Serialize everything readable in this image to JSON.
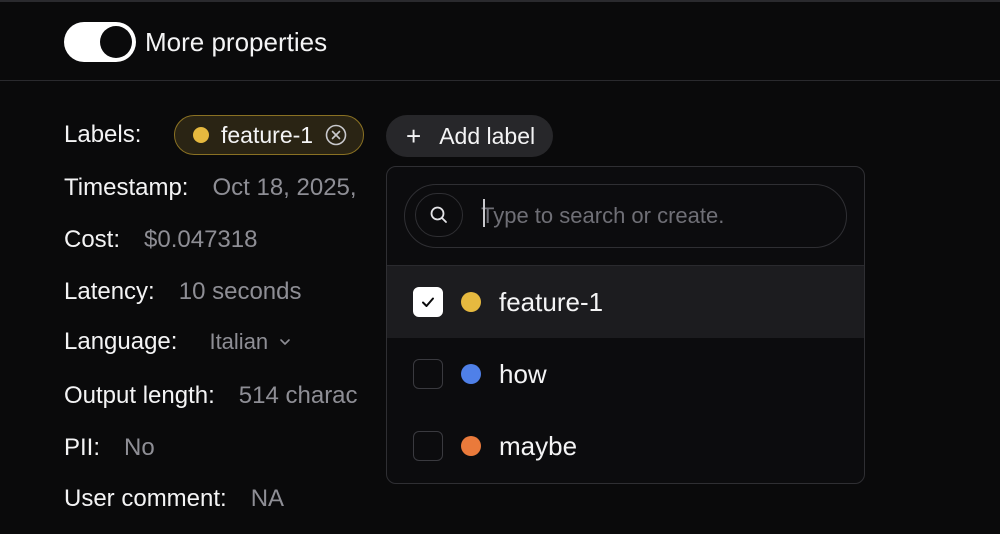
{
  "header": {
    "toggle_label": "More properties",
    "toggle_on": true
  },
  "properties": {
    "labels_label": "Labels:",
    "timestamp_label": "Timestamp:",
    "timestamp_value": "Oct 18, 2025,",
    "cost_label": "Cost:",
    "cost_value": "$0.047318",
    "latency_label": "Latency:",
    "latency_value": "10 seconds",
    "language_label": "Language:",
    "language_value": "Italian",
    "output_length_label": "Output length:",
    "output_length_value": "514 charac",
    "pii_label": "PII:",
    "pii_value": "No",
    "user_comment_label": "User comment:",
    "user_comment_value": "NA"
  },
  "chip": {
    "label": "feature-1",
    "color": "#e6b93f"
  },
  "add_label_button": {
    "icon": "plus-icon",
    "label": "Add label"
  },
  "dropdown": {
    "search_placeholder": "Type to search or create.",
    "options": [
      {
        "label": "feature-1",
        "color": "#e6b93f",
        "checked": true
      },
      {
        "label": "how",
        "color": "#4f80e8",
        "checked": false
      },
      {
        "label": "maybe",
        "color": "#ea7a3b",
        "checked": false
      }
    ]
  },
  "colors": {
    "background": "#0a0a0b",
    "border": "#2a2a2e",
    "muted_text": "#8e8e95"
  }
}
